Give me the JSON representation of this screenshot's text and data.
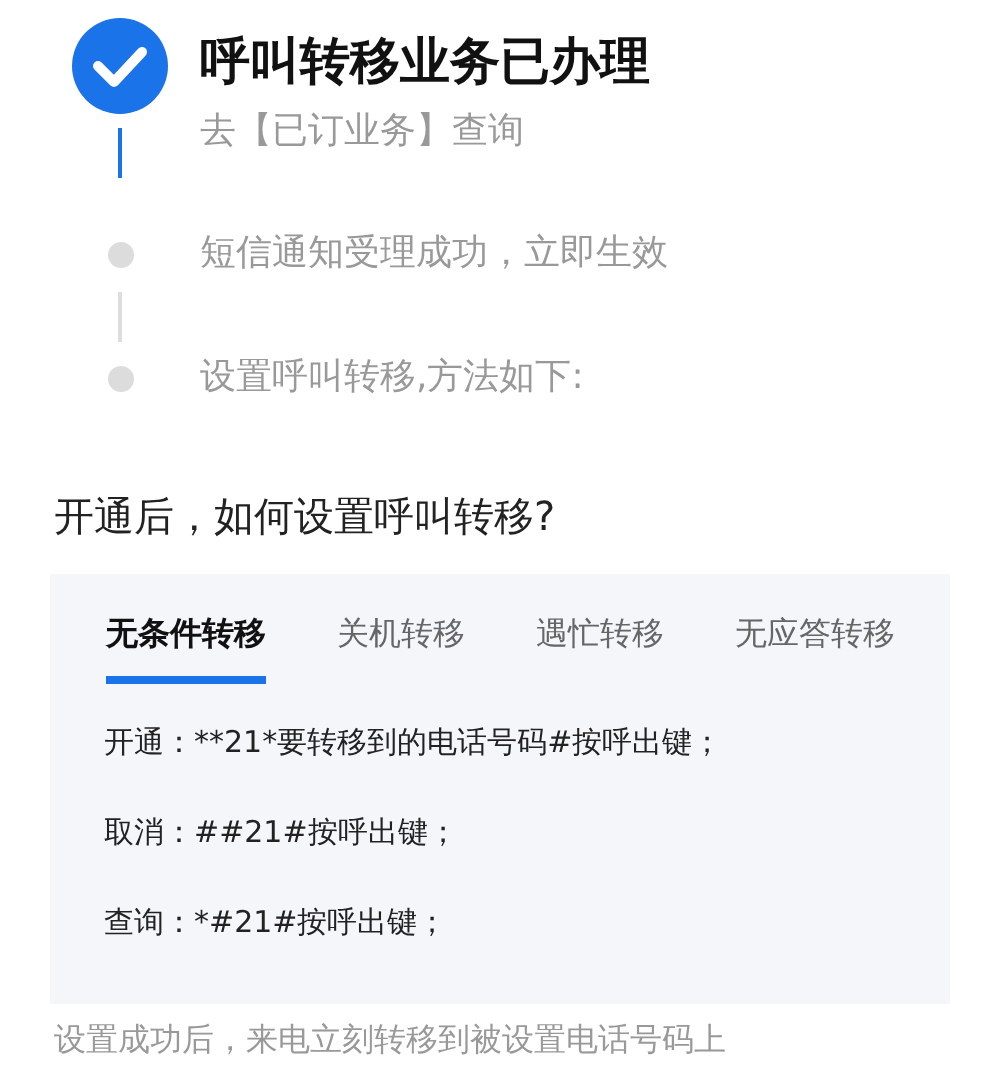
{
  "steps": [
    {
      "title": "呼叫转移业务已办理",
      "subtitle": "去【已订业务】查询",
      "done": true
    },
    {
      "title": "短信通知受理成功，立即生效",
      "done": false
    },
    {
      "title": "设置呼叫转移,方法如下:",
      "done": false
    }
  ],
  "heading": "开通后，如何设置呼叫转移?",
  "tabs": [
    {
      "label": "无条件转移",
      "selected": true
    },
    {
      "label": "关机转移",
      "selected": false
    },
    {
      "label": "遇忙转移",
      "selected": false
    },
    {
      "label": "无应答转移",
      "selected": false
    }
  ],
  "instructions": [
    "开通：**21*要转移到的电话号码#按呼出键；",
    "取消：##21#按呼出键；",
    "查询：*#21#按呼出键；"
  ],
  "footer": "设置成功后，来电立刻转移到被设置电话号码上"
}
